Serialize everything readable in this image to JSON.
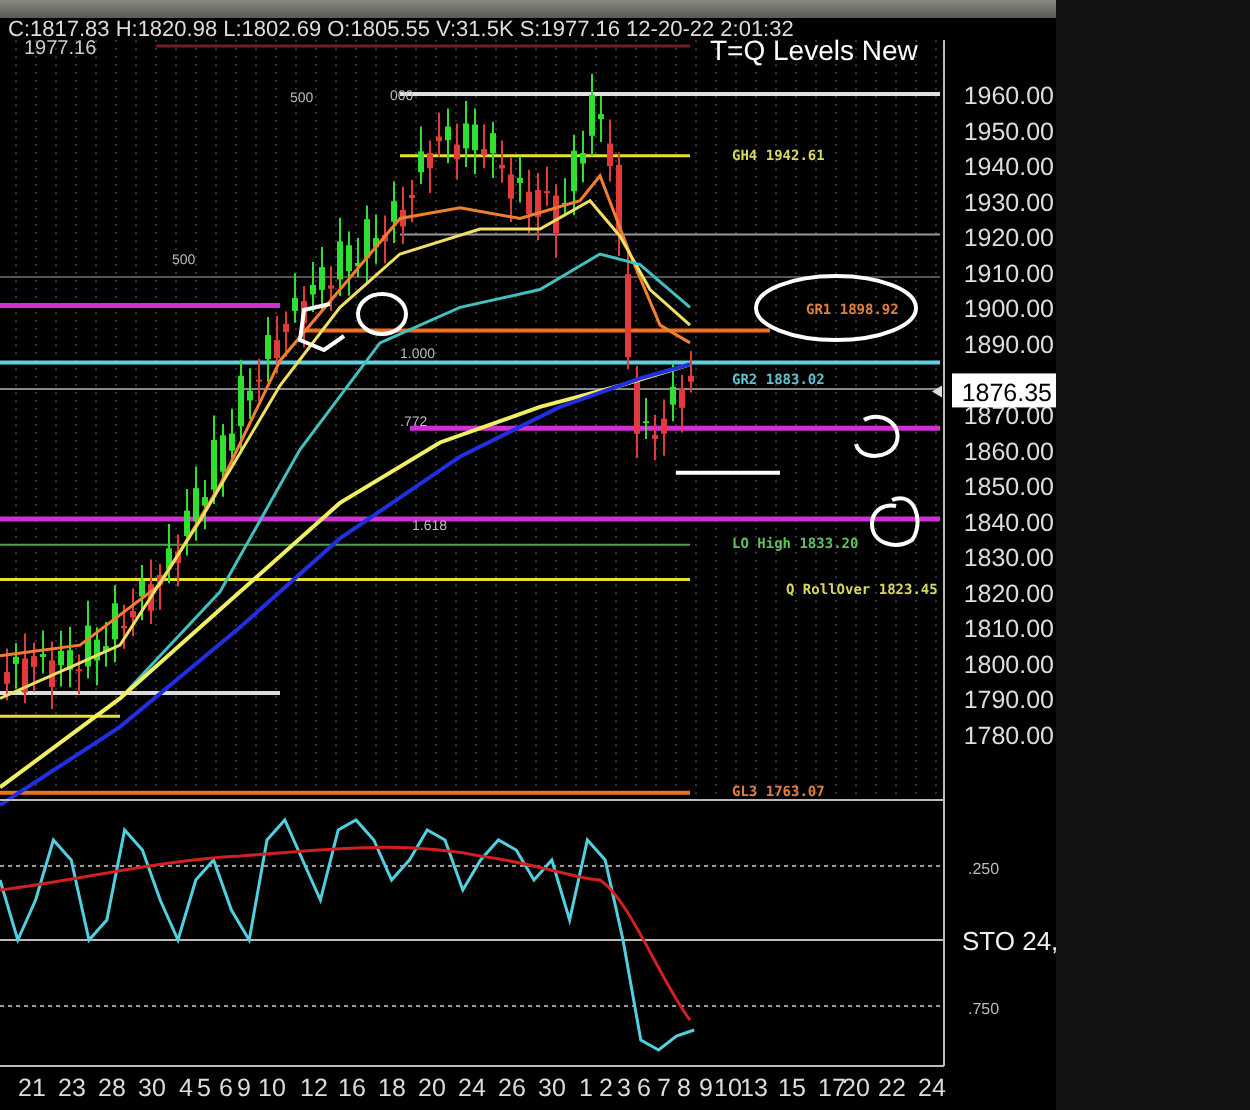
{
  "header": {
    "quote": "C:1817.83 H:1820.98 L:1802.69 O:1805.55 V:31.5K S:1977.16 12-20-22 2:01:32",
    "top_value": "1977.16",
    "title": "T=Q Levels New"
  },
  "price_axis": {
    "ticks": [
      "1960.00",
      "1950.00",
      "1940.00",
      "1930.00",
      "1920.00",
      "1910.00",
      "1900.00",
      "1890.00",
      "1870.00",
      "1860.00",
      "1850.00",
      "1840.00",
      "1830.00",
      "1820.00",
      "1810.00",
      "1800.00",
      "1790.00",
      "1780.00"
    ],
    "last_price": "1876.35"
  },
  "levels": [
    {
      "label": "GH4 1942.61",
      "color": "#d8d860"
    },
    {
      "label": "GR1 1898.92",
      "color": "#e08040"
    },
    {
      "label": "GR2 1883.02",
      "color": "#60c0d0"
    },
    {
      "label": "LO High 1833.20",
      "color": "#60c060"
    },
    {
      "label": "Q RollOver 1823.45",
      "color": "#d8d860"
    },
    {
      "label": "GL3 1763.07",
      "color": "#e08040"
    }
  ],
  "fib_labels": [
    "000",
    "500",
    "500",
    "1.000",
    ".772",
    "1.618"
  ],
  "oscillator": {
    "labels": [
      ".250",
      "STO 24,",
      ".750"
    ]
  },
  "time_axis": [
    "21",
    "23",
    "28",
    "30",
    "4",
    "5",
    "6",
    "9",
    "10",
    "12",
    "16",
    "18",
    "20",
    "24",
    "26",
    "30",
    "1",
    "2",
    "3",
    "6",
    "7",
    "8",
    "9",
    "10",
    "13",
    "15",
    "17",
    "20",
    "22",
    "24"
  ]
}
